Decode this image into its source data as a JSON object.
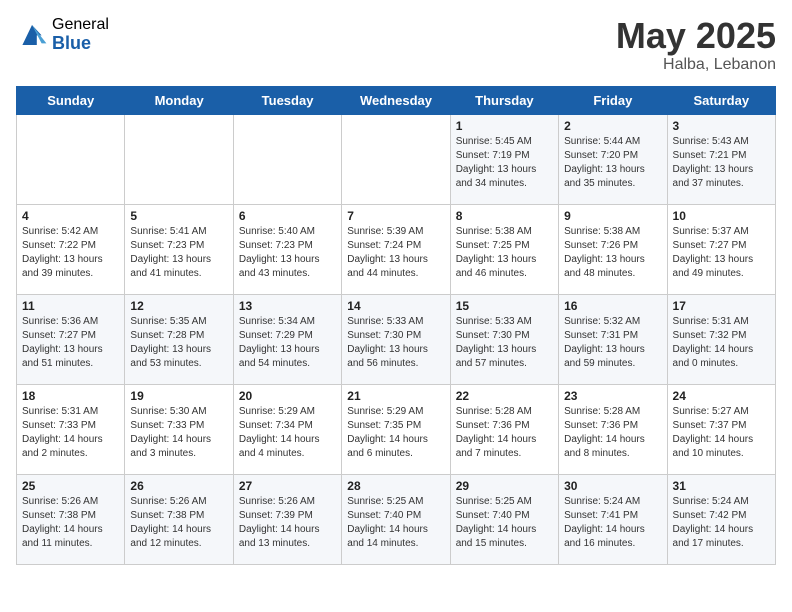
{
  "logo": {
    "general": "General",
    "blue": "Blue"
  },
  "title": "May 2025",
  "location": "Halba, Lebanon",
  "days_header": [
    "Sunday",
    "Monday",
    "Tuesday",
    "Wednesday",
    "Thursday",
    "Friday",
    "Saturday"
  ],
  "weeks": [
    [
      {
        "day": "",
        "info": ""
      },
      {
        "day": "",
        "info": ""
      },
      {
        "day": "",
        "info": ""
      },
      {
        "day": "",
        "info": ""
      },
      {
        "day": "1",
        "info": "Sunrise: 5:45 AM\nSunset: 7:19 PM\nDaylight: 13 hours\nand 34 minutes."
      },
      {
        "day": "2",
        "info": "Sunrise: 5:44 AM\nSunset: 7:20 PM\nDaylight: 13 hours\nand 35 minutes."
      },
      {
        "day": "3",
        "info": "Sunrise: 5:43 AM\nSunset: 7:21 PM\nDaylight: 13 hours\nand 37 minutes."
      }
    ],
    [
      {
        "day": "4",
        "info": "Sunrise: 5:42 AM\nSunset: 7:22 PM\nDaylight: 13 hours\nand 39 minutes."
      },
      {
        "day": "5",
        "info": "Sunrise: 5:41 AM\nSunset: 7:23 PM\nDaylight: 13 hours\nand 41 minutes."
      },
      {
        "day": "6",
        "info": "Sunrise: 5:40 AM\nSunset: 7:23 PM\nDaylight: 13 hours\nand 43 minutes."
      },
      {
        "day": "7",
        "info": "Sunrise: 5:39 AM\nSunset: 7:24 PM\nDaylight: 13 hours\nand 44 minutes."
      },
      {
        "day": "8",
        "info": "Sunrise: 5:38 AM\nSunset: 7:25 PM\nDaylight: 13 hours\nand 46 minutes."
      },
      {
        "day": "9",
        "info": "Sunrise: 5:38 AM\nSunset: 7:26 PM\nDaylight: 13 hours\nand 48 minutes."
      },
      {
        "day": "10",
        "info": "Sunrise: 5:37 AM\nSunset: 7:27 PM\nDaylight: 13 hours\nand 49 minutes."
      }
    ],
    [
      {
        "day": "11",
        "info": "Sunrise: 5:36 AM\nSunset: 7:27 PM\nDaylight: 13 hours\nand 51 minutes."
      },
      {
        "day": "12",
        "info": "Sunrise: 5:35 AM\nSunset: 7:28 PM\nDaylight: 13 hours\nand 53 minutes."
      },
      {
        "day": "13",
        "info": "Sunrise: 5:34 AM\nSunset: 7:29 PM\nDaylight: 13 hours\nand 54 minutes."
      },
      {
        "day": "14",
        "info": "Sunrise: 5:33 AM\nSunset: 7:30 PM\nDaylight: 13 hours\nand 56 minutes."
      },
      {
        "day": "15",
        "info": "Sunrise: 5:33 AM\nSunset: 7:30 PM\nDaylight: 13 hours\nand 57 minutes."
      },
      {
        "day": "16",
        "info": "Sunrise: 5:32 AM\nSunset: 7:31 PM\nDaylight: 13 hours\nand 59 minutes."
      },
      {
        "day": "17",
        "info": "Sunrise: 5:31 AM\nSunset: 7:32 PM\nDaylight: 14 hours\nand 0 minutes."
      }
    ],
    [
      {
        "day": "18",
        "info": "Sunrise: 5:31 AM\nSunset: 7:33 PM\nDaylight: 14 hours\nand 2 minutes."
      },
      {
        "day": "19",
        "info": "Sunrise: 5:30 AM\nSunset: 7:33 PM\nDaylight: 14 hours\nand 3 minutes."
      },
      {
        "day": "20",
        "info": "Sunrise: 5:29 AM\nSunset: 7:34 PM\nDaylight: 14 hours\nand 4 minutes."
      },
      {
        "day": "21",
        "info": "Sunrise: 5:29 AM\nSunset: 7:35 PM\nDaylight: 14 hours\nand 6 minutes."
      },
      {
        "day": "22",
        "info": "Sunrise: 5:28 AM\nSunset: 7:36 PM\nDaylight: 14 hours\nand 7 minutes."
      },
      {
        "day": "23",
        "info": "Sunrise: 5:28 AM\nSunset: 7:36 PM\nDaylight: 14 hours\nand 8 minutes."
      },
      {
        "day": "24",
        "info": "Sunrise: 5:27 AM\nSunset: 7:37 PM\nDaylight: 14 hours\nand 10 minutes."
      }
    ],
    [
      {
        "day": "25",
        "info": "Sunrise: 5:26 AM\nSunset: 7:38 PM\nDaylight: 14 hours\nand 11 minutes."
      },
      {
        "day": "26",
        "info": "Sunrise: 5:26 AM\nSunset: 7:38 PM\nDaylight: 14 hours\nand 12 minutes."
      },
      {
        "day": "27",
        "info": "Sunrise: 5:26 AM\nSunset: 7:39 PM\nDaylight: 14 hours\nand 13 minutes."
      },
      {
        "day": "28",
        "info": "Sunrise: 5:25 AM\nSunset: 7:40 PM\nDaylight: 14 hours\nand 14 minutes."
      },
      {
        "day": "29",
        "info": "Sunrise: 5:25 AM\nSunset: 7:40 PM\nDaylight: 14 hours\nand 15 minutes."
      },
      {
        "day": "30",
        "info": "Sunrise: 5:24 AM\nSunset: 7:41 PM\nDaylight: 14 hours\nand 16 minutes."
      },
      {
        "day": "31",
        "info": "Sunrise: 5:24 AM\nSunset: 7:42 PM\nDaylight: 14 hours\nand 17 minutes."
      }
    ]
  ]
}
